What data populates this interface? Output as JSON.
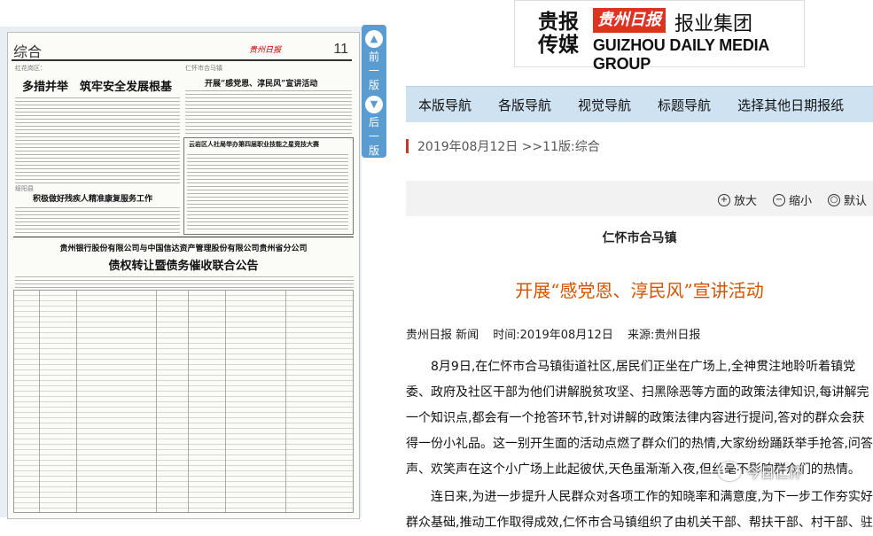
{
  "brand": {
    "short": [
      "贵报",
      "传媒"
    ],
    "seal": "贵州日报",
    "group_cn": "报业集团",
    "group_en": "GUIZHOU DAILY MEDIA GROUP"
  },
  "page_nav": {
    "prev": "前一版",
    "next": "后一版"
  },
  "newspaper": {
    "section": "综合",
    "page_number": "11",
    "masthead": "贵州日报",
    "headline_1_kicker": "红花岗区：",
    "headline_1": "多措并举　筑牢安全发展根基",
    "headline_2": "开展“感党恩、淳民风”宣讲活动",
    "headline_2_kicker": "仁怀市合马镇",
    "headline_3_kicker": "绥阳县",
    "headline_3": "积极做好残疾人精准康复服务工作",
    "headline_4": "云岩区人社局举办第四届职业技能之星竞技大赛",
    "ad_title_1": "贵州银行股份有限公司与中国信达资产管理股份有限公司贵州省分公司",
    "ad_title_2": "债权转让暨债务催收联合公告"
  },
  "nav": {
    "items": [
      "本版导航",
      "各版导航",
      "视觉导航",
      "标题导航",
      "选择其他日期报纸"
    ]
  },
  "dateline": "2019年08月12日 >>11版:综合",
  "zoom": {
    "zoom_in": "放大",
    "zoom_out": "缩小",
    "default": "默认"
  },
  "article": {
    "subtitle": "仁怀市合马镇",
    "title": "开展“感党恩、淳民风”宣讲活动",
    "source_outlet": "贵州日报 新闻",
    "time": "时间:2019年08月12日",
    "source": "来源:贵州日报",
    "paragraphs": [
      "8月9日,在仁怀市合马镇街道社区,居民们正坐在广场上,全神贯注地聆听着镇党委、政府及社区干部为他们讲解脱贫攻坚、扫黑除恶等方面的政策法律知识,每讲解完一个知识点,都会有一个抢答环节,针对讲解的政策法律内容进行提问,答对的群众会获得一份小礼品。这一别开生面的活动点燃了群众们的热情,大家纷纷踊跃举手抢答,问答声、欢笑声在这个小广场上此起彼伏,天色虽渐渐入夜,但丝毫不影响群众们的热情。",
      "连日来,为进一步提升人民群众对各项工作的知晓率和满意度,为下一步工作夯实好群众基础,推动工作取得成效,仁怀市合马镇组织了由机关干部、帮扶干部、村干部、驻"
    ]
  },
  "watermark": "今日仁怀"
}
